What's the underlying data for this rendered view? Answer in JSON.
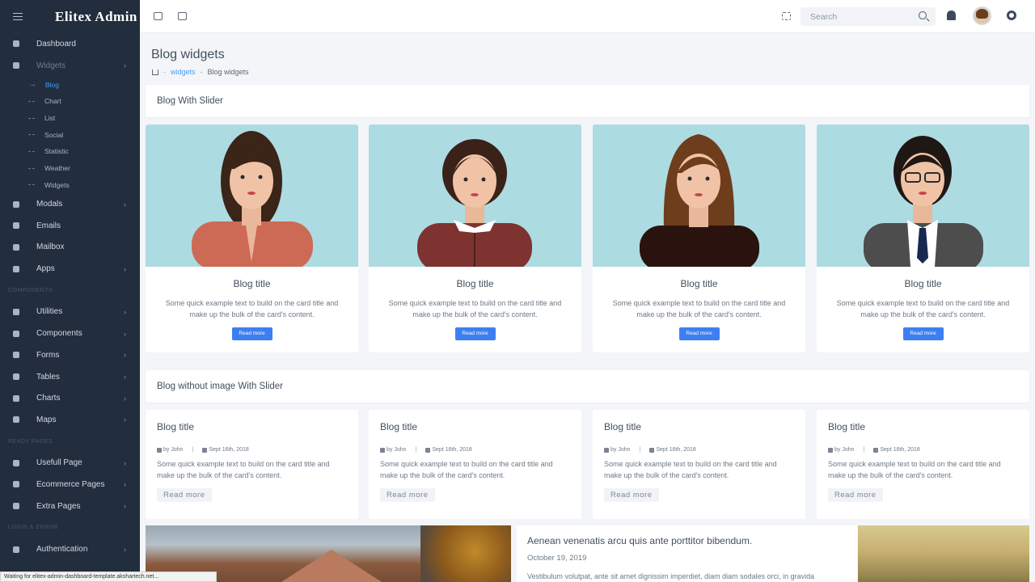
{
  "sidebar": {
    "brand": "Elitex Admin",
    "nav_top": [
      {
        "label": "Dashboard"
      },
      {
        "label": "Widgets"
      }
    ],
    "widgets_sub": [
      {
        "label": "Blog"
      },
      {
        "label": "Chart"
      },
      {
        "label": "List"
      },
      {
        "label": "Social"
      },
      {
        "label": "Statistic"
      },
      {
        "label": "Weather"
      },
      {
        "label": "Widgets"
      }
    ],
    "nav_mid": [
      {
        "label": "Modals"
      },
      {
        "label": "Emails"
      },
      {
        "label": "Mailbox"
      },
      {
        "label": "Apps"
      }
    ],
    "section_components": "COMPONENTS",
    "nav_components": [
      {
        "label": "Utilities"
      },
      {
        "label": "Components"
      },
      {
        "label": "Forms"
      },
      {
        "label": "Tables"
      },
      {
        "label": "Charts"
      },
      {
        "label": "Maps"
      }
    ],
    "section_ready": "READY PAGES",
    "nav_ready": [
      {
        "label": "Usefull Page"
      },
      {
        "label": "Ecommerce Pages"
      },
      {
        "label": "Extra Pages"
      }
    ],
    "section_login": "LOGIN & ERROR",
    "nav_login": [
      {
        "label": "Authentication"
      }
    ]
  },
  "topbar": {
    "search_placeholder": "Search"
  },
  "page": {
    "title": "Blog widgets",
    "breadcrumb": [
      "widgets",
      "Blog widgets"
    ]
  },
  "section1": {
    "title": "Blog With Slider",
    "cards": [
      {
        "title": "Blog title",
        "text": "Some quick example text to build on the card title and make up the bulk of the card's content.",
        "button": "Read more"
      },
      {
        "title": "Blog title",
        "text": "Some quick example text to build on the card title and make up the bulk of the card's content.",
        "button": "Read more"
      },
      {
        "title": "Blog title",
        "text": "Some quick example text to build on the card title and make up the bulk of the card's content.",
        "button": "Read more"
      },
      {
        "title": "Blog title",
        "text": "Some quick example text to build on the card title and make up the bulk of the card's content.",
        "button": "Read more"
      }
    ]
  },
  "section2": {
    "title": "Blog without image With Slider",
    "cards": [
      {
        "title": "Blog title",
        "author": "by John",
        "date": "Sept 16th, 2018",
        "text": "Some quick example text to build on the card title and make up the bulk of the card's content.",
        "button": "Read more"
      },
      {
        "title": "Blog title",
        "author": "by John",
        "date": "Sept 16th, 2018",
        "text": "Some quick example text to build on the card title and make up the bulk of the card's content.",
        "button": "Read more"
      },
      {
        "title": "Blog title",
        "author": "by John",
        "date": "Sept 16th, 2018",
        "text": "Some quick example text to build on the card title and make up the bulk of the card's content.",
        "button": "Read more"
      },
      {
        "title": "Blog title",
        "author": "by John",
        "date": "Sept 16th, 2018",
        "text": "Some quick example text to build on the card title and make up the bulk of the card's content.",
        "button": "Read more"
      }
    ]
  },
  "article": {
    "title": "Aenean venenatis arcu quis ante porttitor bibendum.",
    "date": "October 19, 2019",
    "body": "Vestibulum volutpat, ante sit amet dignissim imperdiet, diam diam sodales orci, in gravida"
  },
  "status_bar": "Waiting for elitex-admin-dashboard-template.akshartech.net...",
  "colors": {
    "sidebar_bg": "#222d3e",
    "accent": "#3d7ff0",
    "portrait_bg": "#addbe2"
  },
  "icons": [
    "menu-icon",
    "copy-icon",
    "mail-icon",
    "fullscreen-icon",
    "search-icon",
    "bell-icon",
    "gear-icon",
    "home-icon",
    "user-icon",
    "calendar-icon"
  ]
}
